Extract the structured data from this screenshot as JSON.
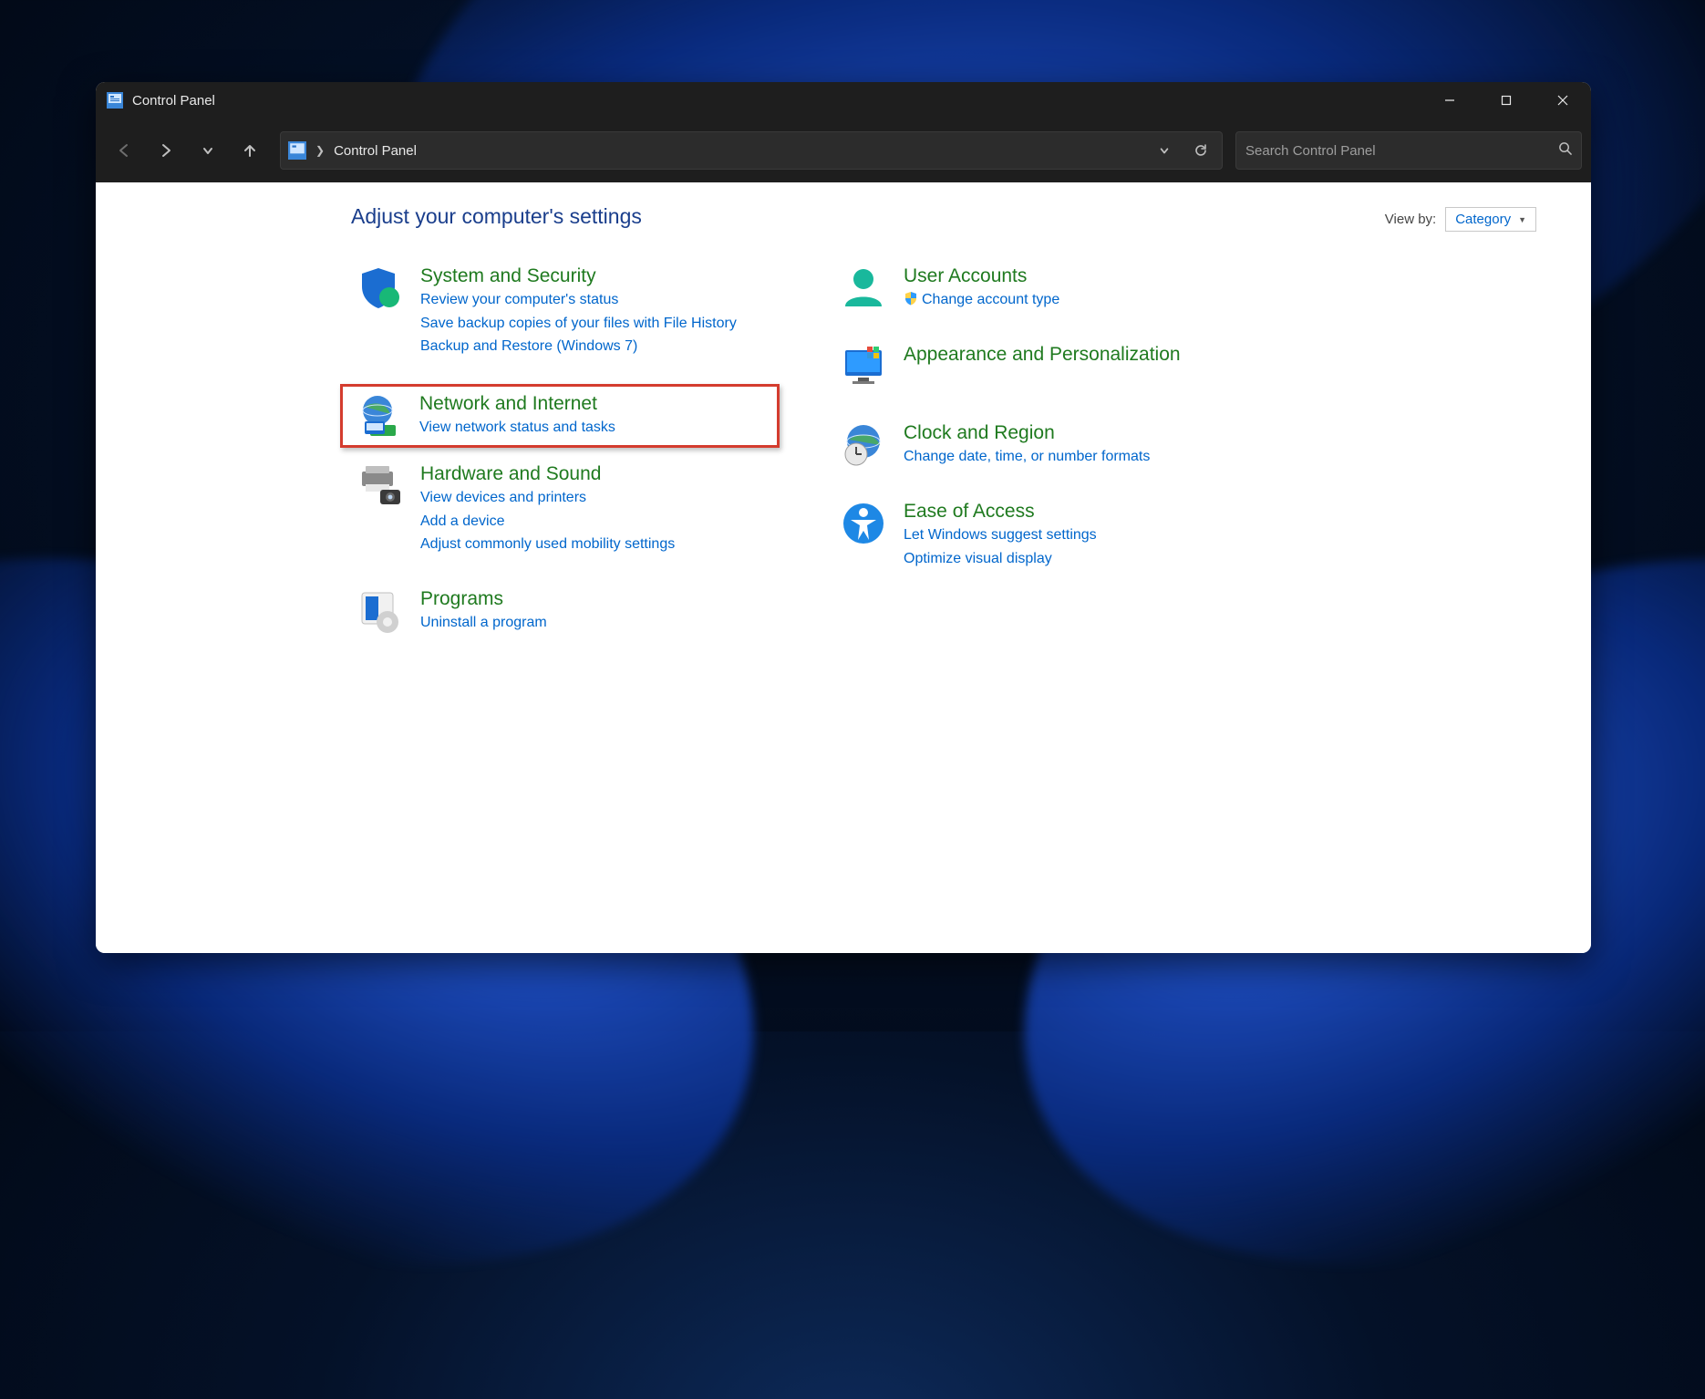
{
  "window": {
    "title": "Control Panel"
  },
  "breadcrumb": {
    "item0": "Control Panel"
  },
  "search": {
    "placeholder": "Search Control Panel"
  },
  "header": {
    "title": "Adjust your computer's settings",
    "viewby_label": "View by:",
    "viewby_value": "Category"
  },
  "left": {
    "system": {
      "title": "System and Security",
      "links": {
        "0": "Review your computer's status",
        "1": "Save backup copies of your files with File History",
        "2": "Backup and Restore (Windows 7)"
      }
    },
    "network": {
      "title": "Network and Internet",
      "links": {
        "0": "View network status and tasks"
      }
    },
    "hardware": {
      "title": "Hardware and Sound",
      "links": {
        "0": "View devices and printers",
        "1": "Add a device",
        "2": "Adjust commonly used mobility settings"
      }
    },
    "programs": {
      "title": "Programs",
      "links": {
        "0": "Uninstall a program"
      }
    }
  },
  "right": {
    "users": {
      "title": "User Accounts",
      "links": {
        "0": "Change account type"
      }
    },
    "appearance": {
      "title": "Appearance and Personalization"
    },
    "clock": {
      "title": "Clock and Region",
      "links": {
        "0": "Change date, time, or number formats"
      }
    },
    "ease": {
      "title": "Ease of Access",
      "links": {
        "0": "Let Windows suggest settings",
        "1": "Optimize visual display"
      }
    }
  },
  "highlight": "network"
}
